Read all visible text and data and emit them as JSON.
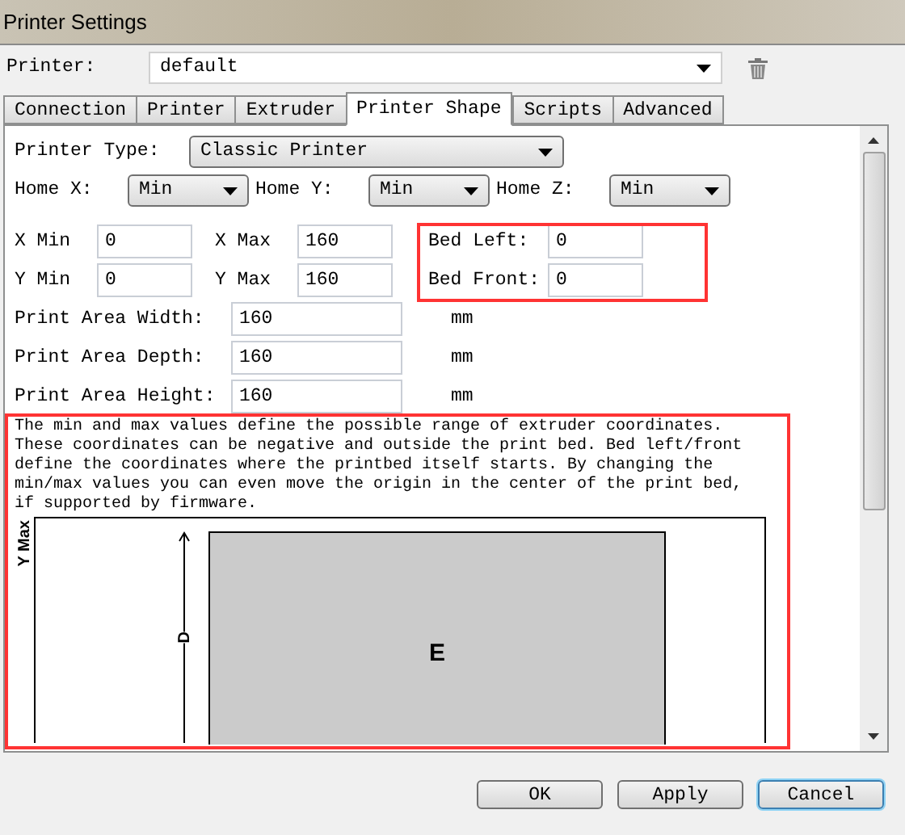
{
  "window": {
    "title": "Printer Settings"
  },
  "printer": {
    "label": "Printer:",
    "value": "default"
  },
  "tabs": [
    {
      "label": "Connection",
      "selected": false
    },
    {
      "label": "Printer",
      "selected": false
    },
    {
      "label": "Extruder",
      "selected": false
    },
    {
      "label": "Printer Shape",
      "selected": true
    },
    {
      "label": "Scripts",
      "selected": false
    },
    {
      "label": "Advanced",
      "selected": false
    }
  ],
  "printer_type": {
    "label": "Printer Type:",
    "value": "Classic Printer"
  },
  "home": [
    {
      "label": "Home X:",
      "value": "Min"
    },
    {
      "label": "Home Y:",
      "value": "Min"
    },
    {
      "label": "Home Z:",
      "value": "Min"
    }
  ],
  "limits": [
    [
      {
        "label": "X Min",
        "value": "0"
      },
      {
        "label": "X Max",
        "value": "160"
      }
    ],
    [
      {
        "label": "Y Min",
        "value": "0"
      },
      {
        "label": "Y Max",
        "value": "160"
      }
    ]
  ],
  "bed": [
    {
      "label": "Bed Left:",
      "value": "0"
    },
    {
      "label": "Bed Front:",
      "value": "0"
    }
  ],
  "area": [
    {
      "label": "Print Area Width:",
      "value": "160",
      "unit": "mm"
    },
    {
      "label": "Print Area Depth:",
      "value": "160",
      "unit": "mm"
    },
    {
      "label": "Print Area Height:",
      "value": "160",
      "unit": "mm"
    }
  ],
  "description": "The min and max values define the possible range of extruder coordinates. These coordinates can be negative and outside the print bed. Bed left/front define the coordinates where the printbed itself starts. By changing the min/max values you can even move the origin in the center of the print bed, if supported by firmware.",
  "diagram": {
    "y_axis_label": "Y Max",
    "depth_label": "D",
    "bed_label": "E"
  },
  "buttons": [
    {
      "label": "OK",
      "default": false
    },
    {
      "label": "Apply",
      "default": false
    },
    {
      "label": "Cancel",
      "default": true
    }
  ]
}
